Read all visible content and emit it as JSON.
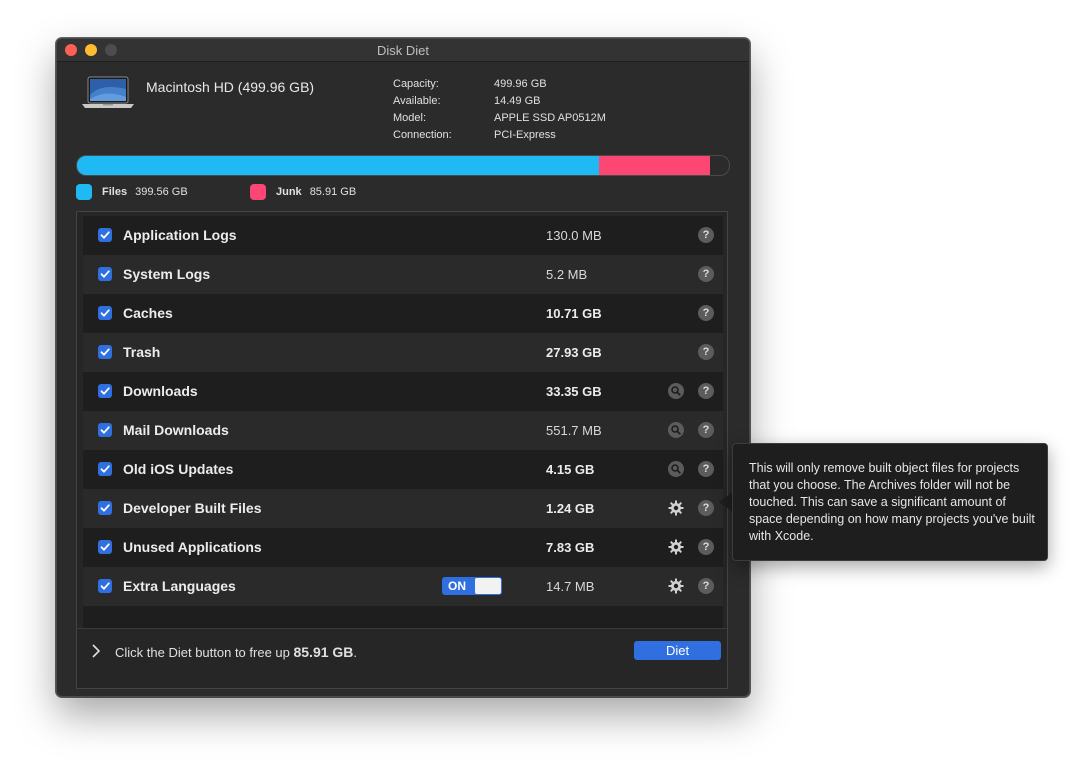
{
  "window": {
    "title": "Disk Diet"
  },
  "disk": {
    "name": "Macintosh HD (499.96 GB)",
    "info": [
      {
        "label": "Capacity:",
        "value": "499.96 GB"
      },
      {
        "label": "Available:",
        "value": "14.49 GB"
      },
      {
        "label": "Model:",
        "value": "APPLE SSD AP0512M"
      },
      {
        "label": "Connection:",
        "value": "PCI-Express"
      }
    ]
  },
  "usage": {
    "files_fraction": 0.8,
    "junk_fraction": 0.17,
    "files_color": "#1fbaf3",
    "junk_color": "#fc4775",
    "legend": {
      "files_label": "Files",
      "files_value": "399.56 GB",
      "junk_label": "Junk",
      "junk_value": "85.91 GB"
    }
  },
  "items": [
    {
      "label": "Application Logs",
      "size": "130.0 MB",
      "bold": false,
      "checked": true,
      "action": "none"
    },
    {
      "label": "System Logs",
      "size": "5.2 MB",
      "bold": false,
      "checked": true,
      "action": "none"
    },
    {
      "label": "Caches",
      "size": "10.71 GB",
      "bold": true,
      "checked": true,
      "action": "none"
    },
    {
      "label": "Trash",
      "size": "27.93 GB",
      "bold": true,
      "checked": true,
      "action": "none"
    },
    {
      "label": "Downloads",
      "size": "33.35 GB",
      "bold": true,
      "checked": true,
      "action": "magnifier-icon"
    },
    {
      "label": "Mail Downloads",
      "size": "551.7 MB",
      "bold": false,
      "checked": true,
      "action": "magnifier-icon"
    },
    {
      "label": "Old iOS Updates",
      "size": "4.15 GB",
      "bold": true,
      "checked": true,
      "action": "magnifier-icon"
    },
    {
      "label": "Developer Built Files",
      "size": "1.24 GB",
      "bold": true,
      "checked": true,
      "action": "gear-icon"
    },
    {
      "label": "Unused Applications",
      "size": "7.83 GB",
      "bold": true,
      "checked": true,
      "action": "gear-icon"
    },
    {
      "label": "Extra Languages",
      "size": "14.7 MB",
      "bold": false,
      "checked": true,
      "action": "gear-icon",
      "toggle": "ON"
    }
  ],
  "help_glyph": "?",
  "footer": {
    "text_prefix": "Click the Diet button to free up ",
    "amount": "85.91 GB",
    "text_suffix": ".",
    "button_label": "Diet"
  },
  "tooltip": {
    "text": "This will only remove built object files for projects that you choose. The Archives folder will not be touched. This can save a significant amount of space depending on how many projects you've built with Xcode."
  }
}
